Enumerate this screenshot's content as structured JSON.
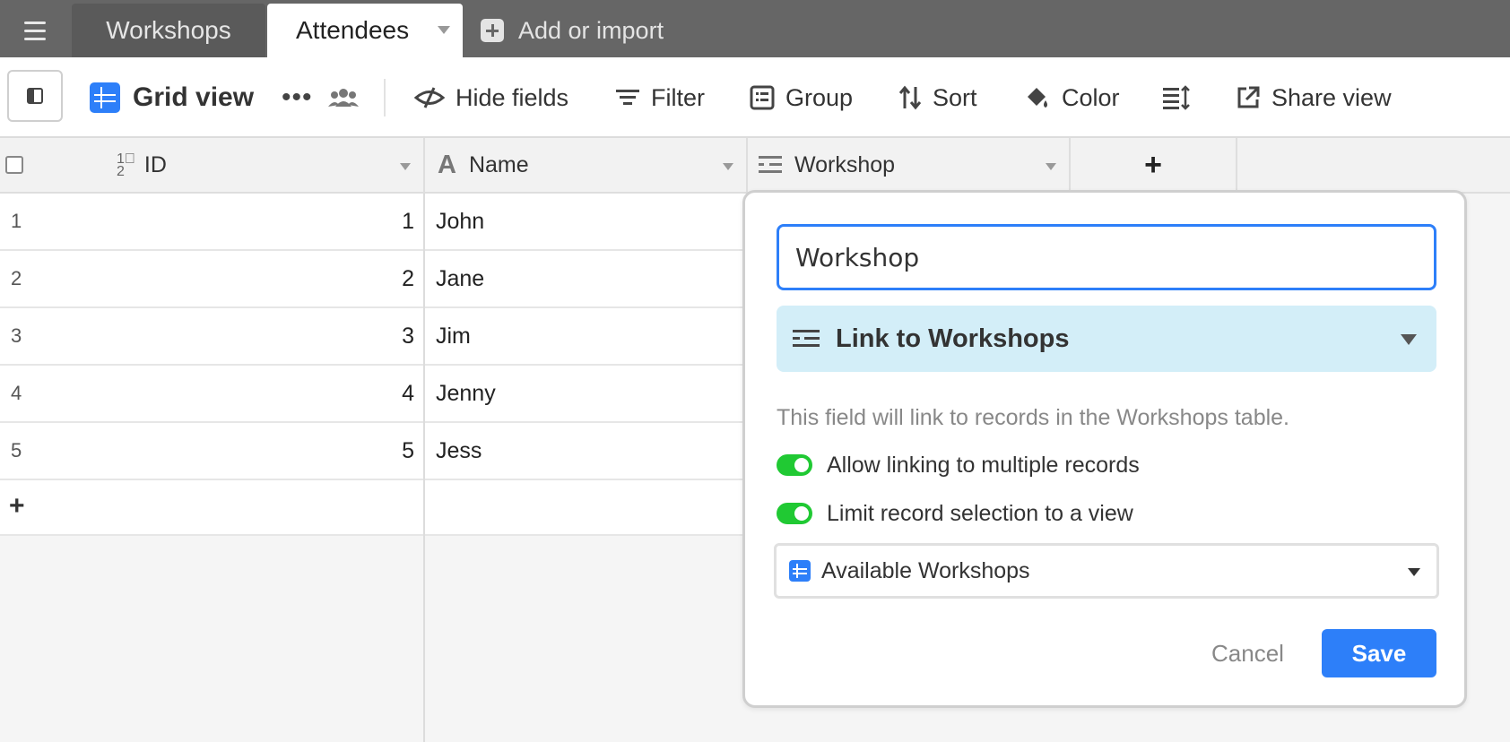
{
  "tabs": {
    "workshops": "Workshops",
    "attendees": "Attendees",
    "add_import": "Add or import"
  },
  "toolbar": {
    "view_name": "Grid view",
    "more": "•••",
    "hide_fields": "Hide fields",
    "filter": "Filter",
    "group": "Group",
    "sort": "Sort",
    "color": "Color",
    "share_view": "Share view"
  },
  "columns": {
    "id": "ID",
    "name": "Name",
    "workshop": "Workshop",
    "add": "+"
  },
  "rows": [
    {
      "num": "1",
      "id": "1",
      "name": "John"
    },
    {
      "num": "2",
      "id": "2",
      "name": "Jane"
    },
    {
      "num": "3",
      "id": "3",
      "name": "Jim"
    },
    {
      "num": "4",
      "id": "4",
      "name": "Jenny"
    },
    {
      "num": "5",
      "id": "5",
      "name": "Jess"
    }
  ],
  "add_row": "+",
  "field_editor": {
    "field_name": "Workshop",
    "field_type": "Link to Workshops",
    "description": "This field will link to records in the Workshops table.",
    "allow_multiple": {
      "label": "Allow linking to multiple records",
      "on": true
    },
    "limit_to_view": {
      "label": "Limit record selection to a view",
      "on": true
    },
    "selected_view": "Available Workshops",
    "cancel": "Cancel",
    "save": "Save"
  },
  "colors": {
    "accent": "#2d7ff9",
    "toggle_on": "#20c933",
    "type_select_bg": "#d3eef8",
    "tabbar": "#666666"
  }
}
